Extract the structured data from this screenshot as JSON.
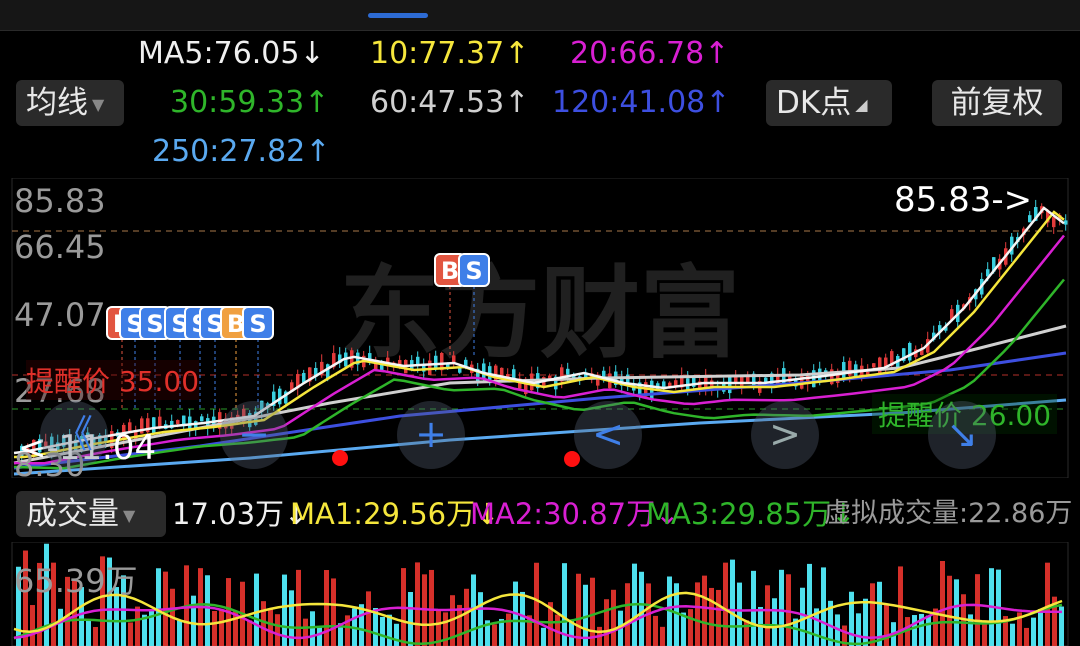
{
  "indicator": {
    "label": "均线"
  },
  "ma": [
    {
      "text": "MA5:76.05↓",
      "color": "#f0f0f0"
    },
    {
      "text": "10:77.37↑",
      "color": "#f5e63c"
    },
    {
      "text": "20:66.78↑",
      "color": "#d81fd2"
    },
    {
      "text": "30:59.33↑",
      "color": "#2fb52a"
    },
    {
      "text": "60:47.53↑",
      "color": "#d0d0d0"
    },
    {
      "text": "120:41.08↑",
      "color": "#3d4fe0"
    },
    {
      "text": "250:27.82↑",
      "color": "#5aa9f0"
    }
  ],
  "dk_button": {
    "label": "DK点"
  },
  "adjust_button": {
    "label": "前复权"
  },
  "price_axis": [
    "85.83",
    "66.45",
    "47.07",
    "27.68",
    "8.30"
  ],
  "high_marker": "85.83->",
  "low_marker": "<-11.04",
  "watermark": "东方财富",
  "reminders": [
    {
      "text": "提醒价 35.00",
      "color": "#e0302a"
    },
    {
      "text": "提醒价 26.00",
      "color": "#2fb52a"
    }
  ],
  "trade_marks": {
    "buy": "B",
    "sell": "S"
  },
  "nav": {
    "first": "《",
    "zoom_out": "−",
    "zoom_in": "+",
    "prev": "<",
    "next": ">",
    "collapse": "↘"
  },
  "volume": {
    "label": "成交量",
    "value": "17.03万↓",
    "ma1": "MA1:29.56万↓",
    "ma2": "MA2:30.87万↓",
    "ma3": "MA3:29.85万↓",
    "virtual": "虚拟成交量:22.86万",
    "axis_top": "65.39万"
  },
  "colors": {
    "up": "#e23b3b",
    "down": "#3ad0e0",
    "blue": "#3f7fe8"
  }
}
